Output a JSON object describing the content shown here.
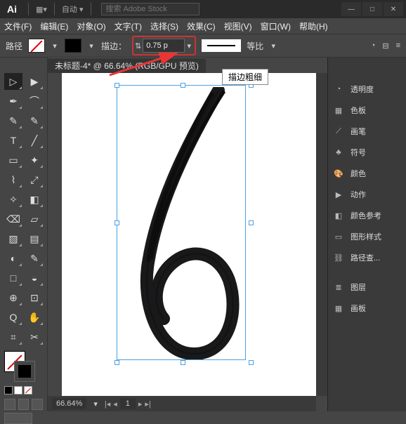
{
  "app": {
    "logo": "Ai",
    "auto": "自动",
    "search_placeholder": "搜索 Adobe Stock"
  },
  "win": {
    "min": "—",
    "max": "□",
    "close": "✕"
  },
  "menu": [
    {
      "label": "文件(F)"
    },
    {
      "label": "编辑(E)"
    },
    {
      "label": "对象(O)"
    },
    {
      "label": "文字(T)"
    },
    {
      "label": "选择(S)"
    },
    {
      "label": "效果(C)"
    },
    {
      "label": "视图(V)"
    },
    {
      "label": "窗口(W)"
    },
    {
      "label": "帮助(H)"
    }
  ],
  "ctrl": {
    "path_label": "路径",
    "stroke_label": "描边：",
    "stroke_weight": "0.75 p",
    "scale_label": "等比"
  },
  "doc": {
    "tab": "未标题-4* @ 66.64% (RGB/GPU 预览)",
    "tooltip": "描边粗细"
  },
  "tools": [
    "▷",
    "▶",
    "✒",
    "⌒",
    "✎",
    "✎",
    "T",
    "╱",
    "▭",
    "✦",
    "⌇",
    "⤢",
    "✧",
    "◧",
    "⌫",
    "▱",
    "▨",
    "▤",
    "◐",
    "✎",
    "□",
    "◒",
    "⊕",
    "⊡",
    "Q",
    "✋",
    "⌗",
    "✂"
  ],
  "panels": [
    {
      "icon": "◔",
      "label": "透明度"
    },
    {
      "icon": "▦",
      "label": "色板"
    },
    {
      "icon": "⟋",
      "label": "画笔"
    },
    {
      "icon": "♣",
      "label": "符号"
    },
    {
      "icon": "🎨",
      "label": "颜色"
    },
    {
      "icon": "▶",
      "label": "动作"
    },
    {
      "icon": "◧",
      "label": "颜色参考"
    },
    {
      "icon": "▭",
      "label": "图形样式"
    },
    {
      "icon": "⛓",
      "label": "路径查..."
    }
  ],
  "panels2": [
    {
      "icon": "≣",
      "label": "图层"
    },
    {
      "icon": "▦",
      "label": "画板"
    }
  ],
  "status": {
    "zoom": "66.64%",
    "page": "1"
  }
}
